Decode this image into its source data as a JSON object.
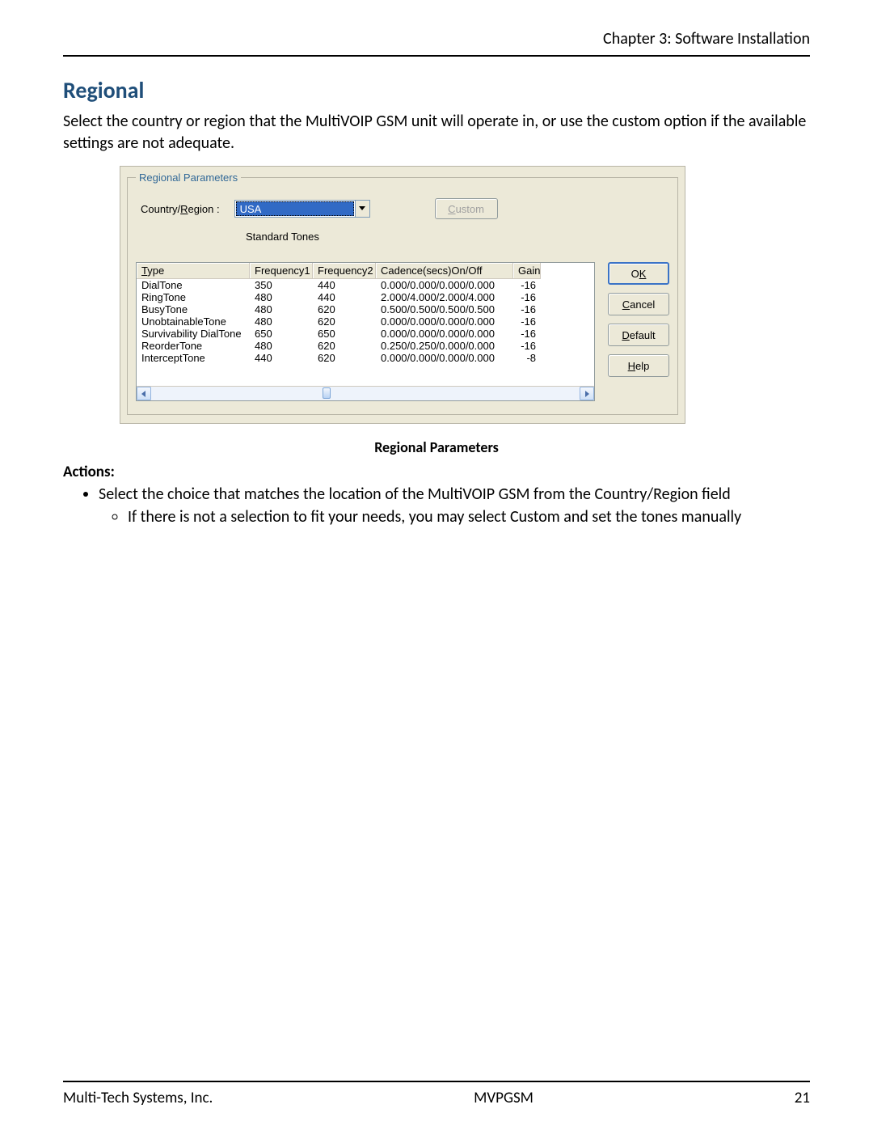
{
  "header": {
    "chapter": "Chapter 3: Software Installation"
  },
  "section": {
    "title": "Regional"
  },
  "intro": "Select the country or region that the MultiVOIP GSM unit will operate in, or use the custom option if the available settings are not adequate.",
  "dialog": {
    "group_title": "Regional Parameters",
    "country_label_pre": "Country/",
    "country_label_u": "R",
    "country_label_post": "egion :",
    "country_value": "USA",
    "custom_btn_u": "C",
    "custom_btn_post": "ustom",
    "standard_tones": "Standard Tones",
    "columns": {
      "type_u": "T",
      "type_post": "ype",
      "freq1": "Frequency1",
      "freq2": "Frequency2",
      "cadence": "Cadence(secs)On/Off",
      "gain": "Gain"
    },
    "rows": [
      {
        "type": "DialTone",
        "f1": "350",
        "f2": "440",
        "cad": "0.000/0.000/0.000/0.000",
        "gain": "-16"
      },
      {
        "type": "RingTone",
        "f1": "480",
        "f2": "440",
        "cad": "2.000/4.000/2.000/4.000",
        "gain": "-16"
      },
      {
        "type": "BusyTone",
        "f1": "480",
        "f2": "620",
        "cad": "0.500/0.500/0.500/0.500",
        "gain": "-16"
      },
      {
        "type": "UnobtainableTone",
        "f1": "480",
        "f2": "620",
        "cad": "0.000/0.000/0.000/0.000",
        "gain": "-16"
      },
      {
        "type": "Survivability DialTone",
        "f1": "650",
        "f2": "650",
        "cad": "0.000/0.000/0.000/0.000",
        "gain": "-16"
      },
      {
        "type": "ReorderTone",
        "f1": "480",
        "f2": "620",
        "cad": "0.250/0.250/0.000/0.000",
        "gain": "-16"
      },
      {
        "type": "InterceptTone",
        "f1": "440",
        "f2": "620",
        "cad": "0.000/0.000/0.000/0.000",
        "gain": "-8"
      }
    ],
    "buttons": {
      "ok_pre": "O",
      "ok_u": "K",
      "cancel_u": "C",
      "cancel_post": "ancel",
      "default_u": "D",
      "default_post": "efault",
      "help_u": "H",
      "help_post": "elp"
    }
  },
  "caption": "Regional Parameters",
  "actions": {
    "heading": "Actions:",
    "b1": "Select the choice that matches the location of the MultiVOIP GSM from the Country/Region field",
    "b1a": "If there is not a selection to fit your needs, you may select Custom and set the tones manually"
  },
  "footer": {
    "left": "Multi-Tech Systems, Inc.",
    "center": "MVPGSM",
    "right": "21"
  }
}
